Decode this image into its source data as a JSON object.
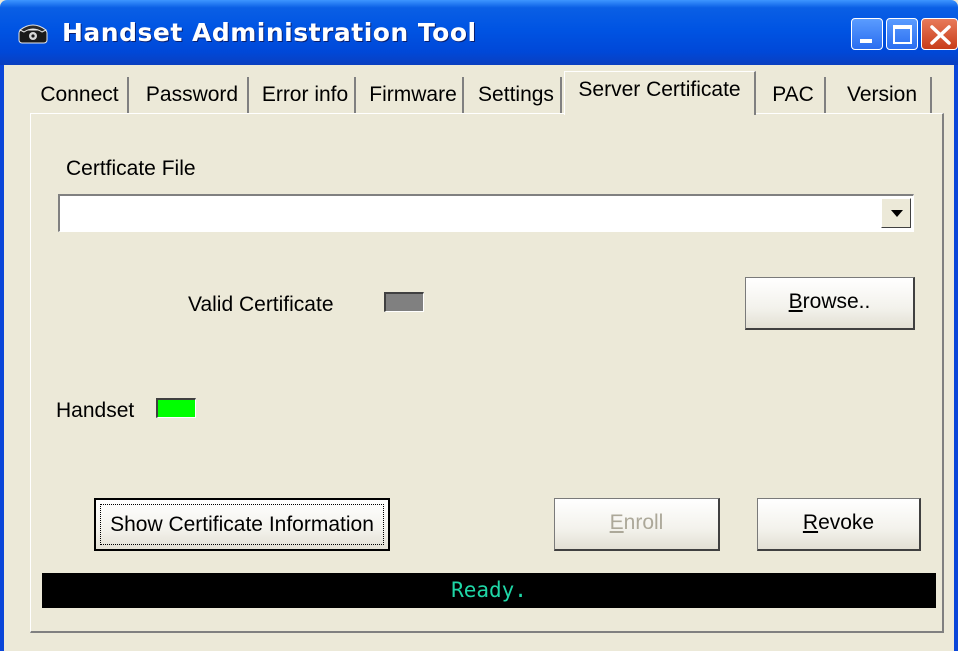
{
  "window": {
    "title": "Handset Administration Tool"
  },
  "tabs": [
    {
      "label": "Connect"
    },
    {
      "label": "Password"
    },
    {
      "label": "Error info"
    },
    {
      "label": "Firmware"
    },
    {
      "label": "Settings"
    },
    {
      "label": "Server Certificate",
      "active": true
    },
    {
      "label": "PAC"
    },
    {
      "label": "Version"
    }
  ],
  "certificate": {
    "file_label": "Certficate File",
    "file_value": "",
    "valid_label": "Valid Certificate",
    "valid_color": "#808080",
    "handset_label": "Handset",
    "handset_color": "#00ff00"
  },
  "buttons": {
    "browse_mnemonic": "B",
    "browse_rest": "rowse..",
    "show_info": "Show Certificate Information",
    "enroll_mnemonic": "E",
    "enroll_rest": "nroll",
    "revoke_mnemonic": "R",
    "revoke_rest": "evoke"
  },
  "status": {
    "text": "Ready."
  }
}
